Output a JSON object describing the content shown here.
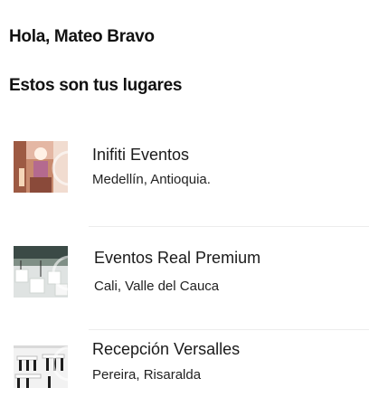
{
  "header": {
    "greeting": "Hola, Mateo Bravo",
    "section_title": "Estos son tus lugares"
  },
  "venues": [
    {
      "name": "Inifiti Eventos",
      "location": "Medellín, Antioquia.",
      "thumbnail": "venue-photo-decorated-hall"
    },
    {
      "name": "Eventos Real Premium",
      "location": "Cali, Valle del Cauca",
      "thumbnail": "venue-photo-lounge-terrace"
    },
    {
      "name": "Recepción Versalles",
      "location": "Pereira, Risaralda",
      "thumbnail": "venue-photo-banquet-room"
    }
  ],
  "colors": {
    "background": "#ffffff",
    "text": "#111111",
    "divider": "#ececec"
  }
}
